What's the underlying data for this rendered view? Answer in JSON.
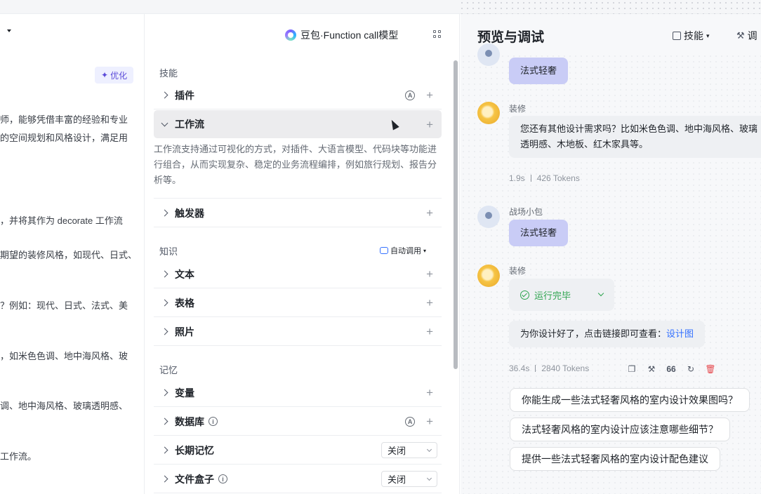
{
  "left": {
    "optimize_label": "优化",
    "prompt_lines": [
      "师，能够凭借丰富的经验和专业",
      "的空间规划和风格设计，满足用",
      "，并将其作为 decorate 工作流",
      "期望的装修风格，如现代、日式、",
      "？例如：现代、日式、法式、美",
      "，如米色色调、地中海风格、玻",
      "调、地中海风格、玻璃透明感、",
      "工作流。"
    ]
  },
  "middle": {
    "model_name": "豆包·Function call模型",
    "skills_title": "技能",
    "knowledge_title": "知识",
    "memory_title": "记忆",
    "auto_call_label": "自动调用",
    "workflow_desc": "工作流支持通过可视化的方式，对插件、大语言模型、代码块等功能进行组合，从而实现复杂、稳定的业务流程编排，例如旅行规划、报告分析等。",
    "a_badge": "A",
    "rows": {
      "plugin": "插件",
      "workflow": "工作流",
      "trigger": "触发器",
      "text": "文本",
      "table": "表格",
      "photo": "照片",
      "variable": "变量",
      "database": "数据库",
      "long_memory": "长期记忆",
      "file_box": "文件盒子"
    },
    "select_value_long_memory": "关闭",
    "select_value_file_box": "关闭"
  },
  "preview": {
    "title": "预览与调试",
    "skill_menu": "技能",
    "debug_menu": "调",
    "messages": {
      "user_top": "法式轻奢",
      "bot_name_1": "装修",
      "bot_text_1": "您还有其他设计需求吗？比如米色色调、地中海风格、玻璃透明感、木地板、红木家具等。",
      "meta_1_time": "1.9s",
      "meta_1_tokens": "426 Tokens",
      "user_name": "战场小包",
      "user_text": "法式轻奢",
      "bot_name_2": "装修",
      "run_status": "运行完毕",
      "bot_text_2": "为你设计好了，点击链接即可查看：",
      "bot_link": "设计图",
      "meta_2_time": "36.4s",
      "meta_2_tokens": "2840 Tokens"
    },
    "suggestions": [
      "你能生成一些法式轻奢风格的室内设计效果图吗？",
      "法式轻奢风格的室内设计应该注意哪些细节？",
      "提供一些法式轻奢风格的室内设计配色建议"
    ]
  }
}
